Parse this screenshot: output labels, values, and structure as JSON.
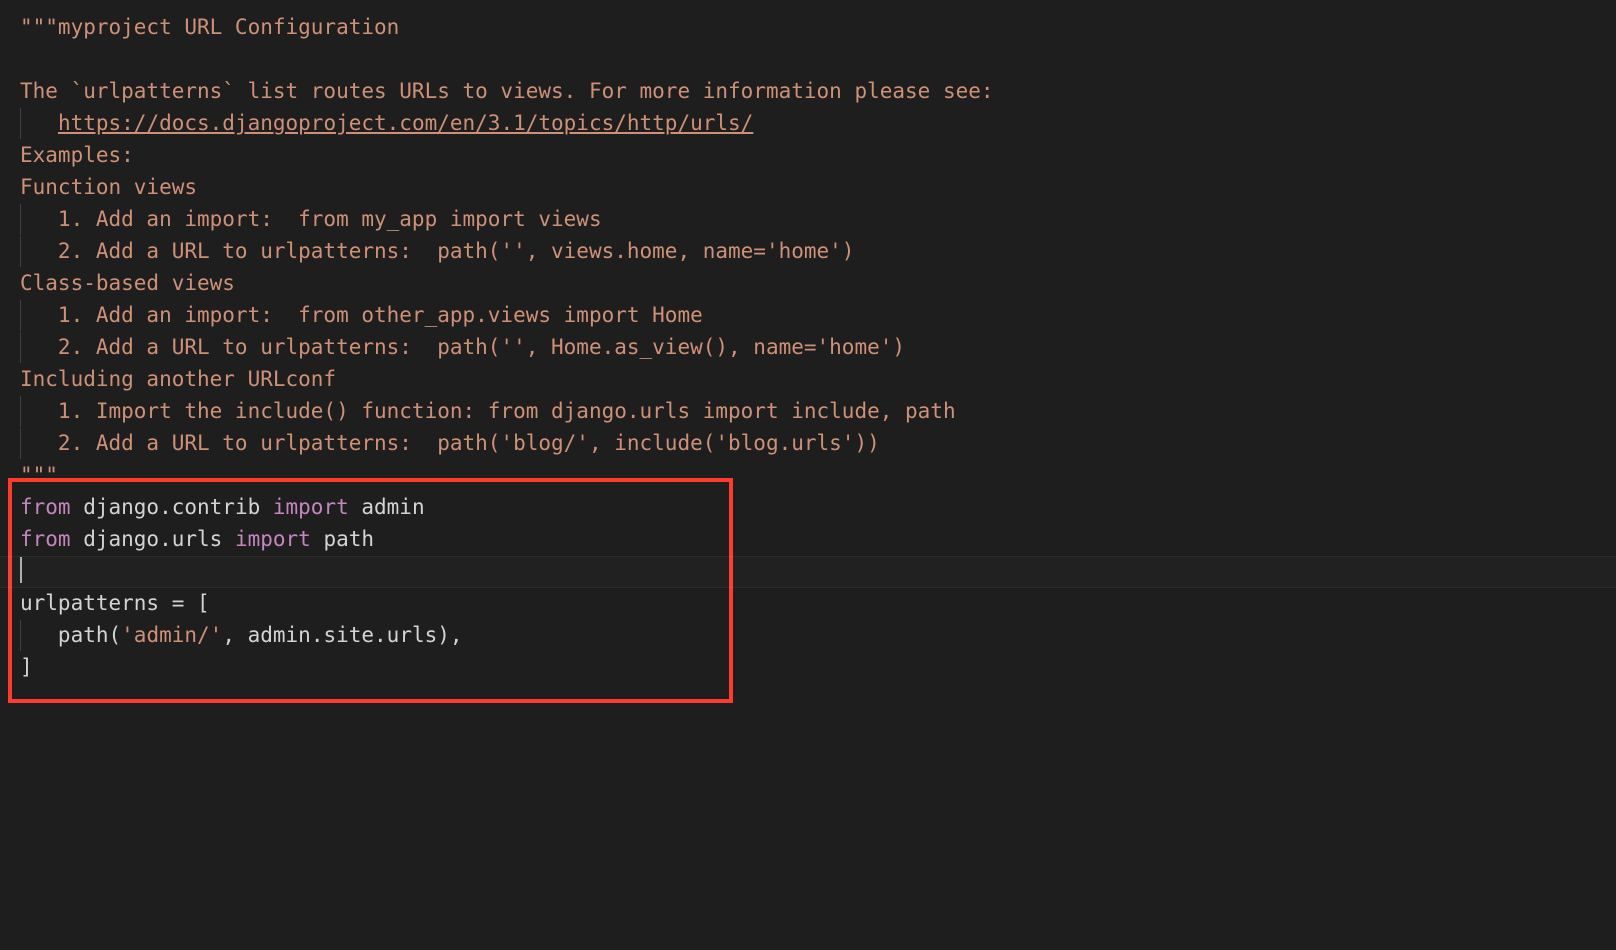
{
  "colors": {
    "bg": "#1e1e1e",
    "string": "#ce9178",
    "keyword": "#c586c0",
    "default": "#d4d4d4",
    "highlight_box": "#ff3b30"
  },
  "lines": [
    {
      "indent": 0,
      "tokens": [
        {
          "cls": "tk-string",
          "text": "\"\"\"myproject URL Configuration"
        }
      ]
    },
    {
      "indent": 0,
      "tokens": []
    },
    {
      "indent": 0,
      "tokens": [
        {
          "cls": "tk-string",
          "text": "The `urlpatterns` list routes URLs to views. For more information please see:"
        }
      ]
    },
    {
      "indent": 1,
      "tokens": [
        {
          "cls": "tk-string",
          "text": "   "
        },
        {
          "cls": "tk-string tk-underline",
          "text": "https://docs.djangoproject.com/en/3.1/topics/http/urls/"
        }
      ]
    },
    {
      "indent": 0,
      "tokens": [
        {
          "cls": "tk-string",
          "text": "Examples:"
        }
      ]
    },
    {
      "indent": 0,
      "tokens": [
        {
          "cls": "tk-string",
          "text": "Function views"
        }
      ]
    },
    {
      "indent": 1,
      "tokens": [
        {
          "cls": "tk-string",
          "text": "   1. Add an import:  from my_app import views"
        }
      ]
    },
    {
      "indent": 1,
      "tokens": [
        {
          "cls": "tk-string",
          "text": "   2. Add a URL to urlpatterns:  path('', views.home, name='home')"
        }
      ]
    },
    {
      "indent": 0,
      "tokens": [
        {
          "cls": "tk-string",
          "text": "Class-based views"
        }
      ]
    },
    {
      "indent": 1,
      "tokens": [
        {
          "cls": "tk-string",
          "text": "   1. Add an import:  from other_app.views import Home"
        }
      ]
    },
    {
      "indent": 1,
      "tokens": [
        {
          "cls": "tk-string",
          "text": "   2. Add a URL to urlpatterns:  path('', Home.as_view(), name='home')"
        }
      ]
    },
    {
      "indent": 0,
      "tokens": [
        {
          "cls": "tk-string",
          "text": "Including another URLconf"
        }
      ]
    },
    {
      "indent": 1,
      "tokens": [
        {
          "cls": "tk-string",
          "text": "   1. Import the include() function: from django.urls import include, path"
        }
      ]
    },
    {
      "indent": 1,
      "tokens": [
        {
          "cls": "tk-string",
          "text": "   2. Add a URL to urlpatterns:  path('blog/', include('blog.urls'))"
        }
      ]
    },
    {
      "indent": 0,
      "tokens": [
        {
          "cls": "tk-string",
          "text": "\"\"\""
        }
      ]
    },
    {
      "indent": 0,
      "tokens": [
        {
          "cls": "tk-keyword",
          "text": "from"
        },
        {
          "cls": "tk-default",
          "text": " django.contrib "
        },
        {
          "cls": "tk-keyword",
          "text": "import"
        },
        {
          "cls": "tk-default",
          "text": " admin"
        }
      ]
    },
    {
      "indent": 0,
      "tokens": [
        {
          "cls": "tk-keyword",
          "text": "from"
        },
        {
          "cls": "tk-default",
          "text": " django.urls "
        },
        {
          "cls": "tk-keyword",
          "text": "import"
        },
        {
          "cls": "tk-default",
          "text": " path"
        }
      ]
    },
    {
      "indent": 0,
      "caret": true,
      "cursorLine": true,
      "tokens": []
    },
    {
      "indent": 0,
      "tokens": [
        {
          "cls": "tk-default",
          "text": "urlpatterns = ["
        }
      ]
    },
    {
      "indent": 1,
      "tokens": [
        {
          "cls": "tk-default",
          "text": "   path("
        },
        {
          "cls": "tk-string",
          "text": "'admin/'"
        },
        {
          "cls": "tk-default",
          "text": ", admin.site.urls),"
        }
      ]
    },
    {
      "indent": 0,
      "tokens": [
        {
          "cls": "tk-default",
          "text": "]"
        }
      ]
    }
  ]
}
